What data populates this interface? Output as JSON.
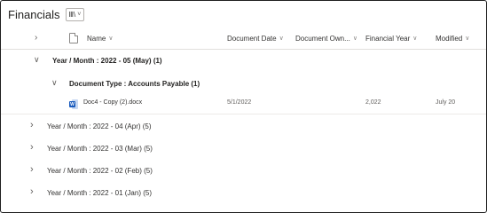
{
  "library": {
    "title": "Financials",
    "view_icon": "Ⅲ\\",
    "view_chevron": "˅"
  },
  "columns": {
    "name": "Name",
    "document_date": "Document Date",
    "document_owner": "Document Own...",
    "financial_year": "Financial Year",
    "modified": "Modified"
  },
  "groups": [
    {
      "label": "Year / Month : 2022 - 05 (May) (1)",
      "expanded": true
    },
    {
      "label": "Year / Month : 2022 - 04 (Apr) (5)",
      "expanded": false
    },
    {
      "label": "Year / Month : 2022 - 03 (Mar) (5)",
      "expanded": false
    },
    {
      "label": "Year / Month : 2022 - 02 (Feb) (5)",
      "expanded": false
    },
    {
      "label": "Year / Month : 2022 - 01 (Jan) (5)",
      "expanded": false
    }
  ],
  "subgroup": {
    "label": "Document Type : Accounts Payable (1)",
    "expanded": true
  },
  "file": {
    "icon_letter": "W",
    "name": "Doc4 - Copy (2).docx",
    "document_date": "5/1/2022",
    "financial_year": "2,022",
    "modified": "July 20"
  },
  "glyphs": {
    "expanded": "∨",
    "collapsed": "›",
    "sort": "∨"
  }
}
